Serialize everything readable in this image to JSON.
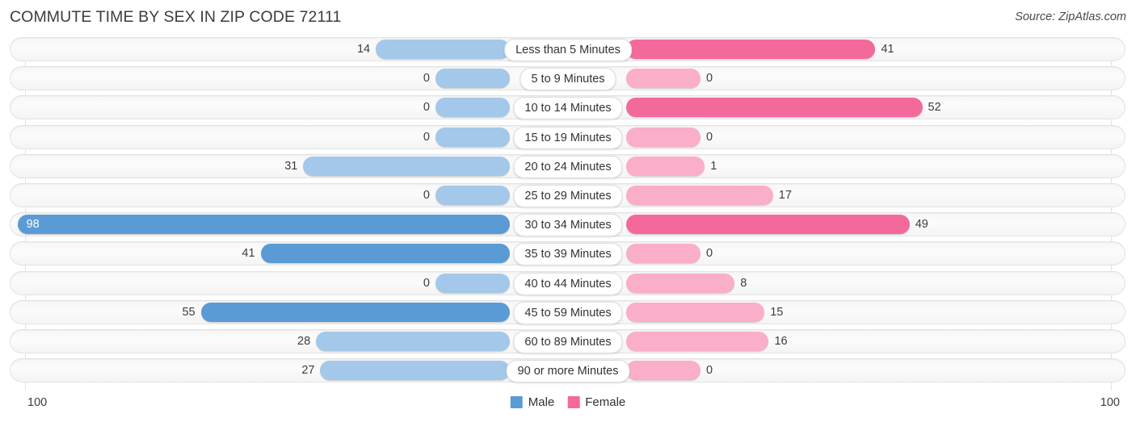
{
  "header": {
    "title": "COMMUTE TIME BY SEX IN ZIP CODE 72111",
    "source": "Source: ZipAtlas.com"
  },
  "axis": {
    "left_label": "100",
    "right_label": "100"
  },
  "legend": {
    "male_label": "Male",
    "female_label": "Female",
    "male_color": "#5b9bd5",
    "female_color": "#f4699c"
  },
  "colors": {
    "male_strong": "#5b9bd5",
    "male_light": "#a4c8e9",
    "female_strong": "#f4699c",
    "female_light": "#fbaec9",
    "track_bg": "#f7f7f7",
    "track_border": "#e3e3e3"
  },
  "chart_data": {
    "type": "bar",
    "title": "COMMUTE TIME BY SEX IN ZIP CODE 72111",
    "subtitle": "Source: ZipAtlas.com",
    "orientation": "horizontal-diverging",
    "xlabel": "",
    "ylabel": "",
    "xlim": [
      0,
      100
    ],
    "grid": true,
    "legend_position": "bottom-center",
    "categories": [
      "Less than 5 Minutes",
      "5 to 9 Minutes",
      "10 to 14 Minutes",
      "15 to 19 Minutes",
      "20 to 24 Minutes",
      "25 to 29 Minutes",
      "30 to 34 Minutes",
      "35 to 39 Minutes",
      "40 to 44 Minutes",
      "45 to 59 Minutes",
      "60 to 89 Minutes",
      "90 or more Minutes"
    ],
    "series": [
      {
        "name": "Male",
        "color": "#5b9bd5",
        "values": [
          14,
          0,
          0,
          0,
          31,
          0,
          98,
          41,
          0,
          55,
          28,
          27
        ]
      },
      {
        "name": "Female",
        "color": "#f4699c",
        "values": [
          41,
          0,
          52,
          0,
          1,
          17,
          49,
          0,
          8,
          15,
          16,
          0
        ]
      }
    ]
  },
  "rows": [
    {
      "label": "Less than 5 Minutes",
      "male": 14,
      "female": 41
    },
    {
      "label": "5 to 9 Minutes",
      "male": 0,
      "female": 0
    },
    {
      "label": "10 to 14 Minutes",
      "male": 0,
      "female": 52
    },
    {
      "label": "15 to 19 Minutes",
      "male": 0,
      "female": 0
    },
    {
      "label": "20 to 24 Minutes",
      "male": 31,
      "female": 1
    },
    {
      "label": "25 to 29 Minutes",
      "male": 0,
      "female": 17
    },
    {
      "label": "30 to 34 Minutes",
      "male": 98,
      "female": 49
    },
    {
      "label": "35 to 39 Minutes",
      "male": 41,
      "female": 0
    },
    {
      "label": "40 to 44 Minutes",
      "male": 0,
      "female": 8
    },
    {
      "label": "45 to 59 Minutes",
      "male": 55,
      "female": 15
    },
    {
      "label": "60 to 89 Minutes",
      "male": 28,
      "female": 16
    },
    {
      "label": "90 or more Minutes",
      "male": 27,
      "female": 0
    }
  ]
}
